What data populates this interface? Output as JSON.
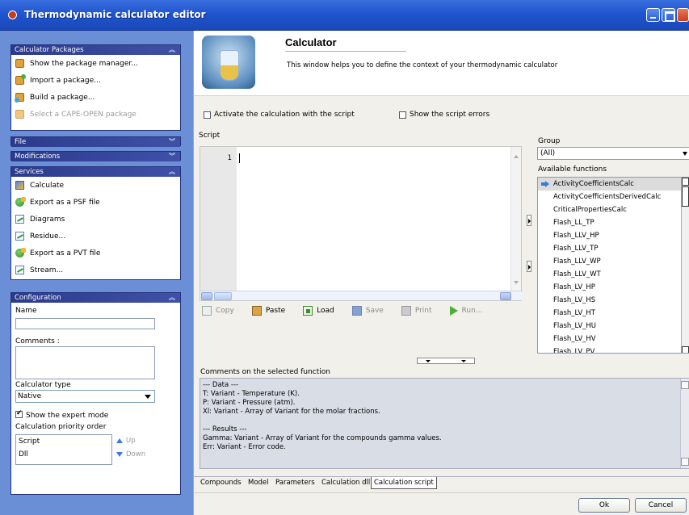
{
  "window": {
    "title": "Thermodynamic calculator editor"
  },
  "packages": {
    "header": "Calculator Packages",
    "items": [
      {
        "label": "Show the package manager...",
        "icon": "package-manager-icon"
      },
      {
        "label": "Import a package...",
        "icon": "import-package-icon"
      },
      {
        "label": "Build a package...",
        "icon": "build-package-icon"
      },
      {
        "label": "Select a CAPE-OPEN package",
        "icon": "cape-open-icon",
        "disabled": true
      }
    ]
  },
  "file_section": {
    "header": "File"
  },
  "modifications_section": {
    "header": "Modifications"
  },
  "services": {
    "header": "Services",
    "items": [
      {
        "label": "Calculate",
        "icon": "calculate-icon"
      },
      {
        "label": "Export as a PSF file",
        "icon": "export-psf-icon"
      },
      {
        "label": "Diagrams",
        "icon": "diagrams-icon"
      },
      {
        "label": "Residue...",
        "icon": "residue-icon"
      },
      {
        "label": "Export as a PVT file",
        "icon": "export-pvt-icon"
      },
      {
        "label": "Stream...",
        "icon": "stream-icon"
      }
    ]
  },
  "configuration": {
    "header": "Configuration",
    "name_label": "Name",
    "name_value": "",
    "comments_label": "Comments :",
    "comments_value": "",
    "calc_type_label": "Calculator type",
    "calc_type_value": "Native",
    "expert_mode_label": "Show the expert mode",
    "expert_mode_checked": true,
    "priority_label": "Calculation priority order",
    "priority_items": [
      "Script",
      "Dll"
    ],
    "up_label": "Up",
    "down_label": "Down"
  },
  "header": {
    "title": "Calculator",
    "description": "This window helps you to define the context of your thermodynamic calculator"
  },
  "options": {
    "activate_label": "Activate the calculation with the script",
    "activate_checked": false,
    "show_errors_label": "Show the script errors",
    "show_errors_checked": false
  },
  "script": {
    "label": "Script",
    "line_number": "1",
    "content": ""
  },
  "toolbar": {
    "copy": "Copy",
    "paste": "Paste",
    "load": "Load",
    "save": "Save",
    "print": "Print",
    "run": "Run..."
  },
  "group": {
    "label": "Group",
    "value": "(All)"
  },
  "functions": {
    "label": "Available functions",
    "selected": "ActivityCoefficientsCalc",
    "items": [
      "ActivityCoefficientsCalc",
      "ActivityCoefficientsDerivedCalc",
      "CriticalPropertiesCalc",
      "Flash_LL_TP",
      "Flash_LLV_HP",
      "Flash_LLV_TP",
      "Flash_LLV_WP",
      "Flash_LLV_WT",
      "Flash_LV_HP",
      "Flash_LV_HS",
      "Flash_LV_HT",
      "Flash_LV_HU",
      "Flash_LV_HV",
      "Flash_LV_PV"
    ]
  },
  "comments": {
    "label": "Comments on the selected function",
    "text": "--- Data ---\nT: Variant - Temperature (K).\nP: Variant - Pressure (atm).\nXl: Variant - Array of Variant for the molar fractions.\n\n--- Results ---\nGamma: Variant - Array of Variant for the compounds gamma values.\nErr: Variant - Error code."
  },
  "tabs": {
    "items": [
      "Compounds",
      "Model",
      "Parameters",
      "Calculation dll",
      "Calculation script"
    ],
    "active": "Calculation script"
  },
  "buttons": {
    "ok": "Ok",
    "cancel": "Cancel"
  }
}
